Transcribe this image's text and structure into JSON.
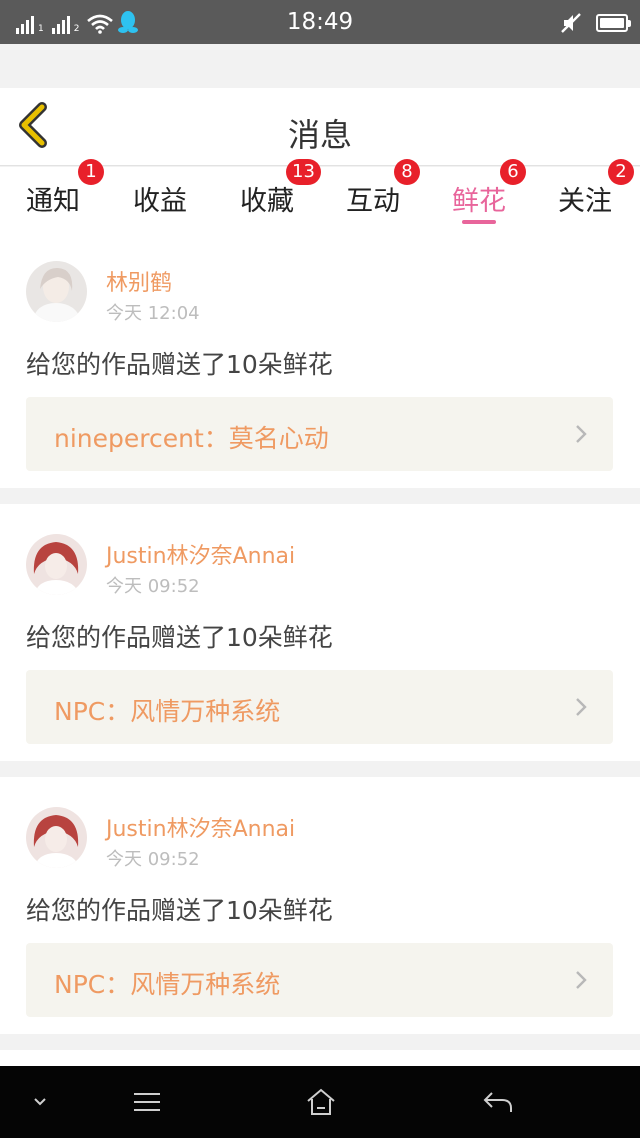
{
  "status_bar": {
    "time": "18:49",
    "sim1_label": "1",
    "sim2_label": "2"
  },
  "header": {
    "title": "消息",
    "accent_color": "#e8c000"
  },
  "tabs": [
    {
      "label": "通知",
      "badge": "1"
    },
    {
      "label": "收益",
      "badge": ""
    },
    {
      "label": "收藏",
      "badge": "13"
    },
    {
      "label": "互动",
      "badge": "8"
    },
    {
      "label": "鲜花",
      "badge": "6",
      "active": true
    },
    {
      "label": "关注",
      "badge": "2"
    }
  ],
  "colors": {
    "active_tab": "#e8659b",
    "badge": "#e8202a",
    "username": "#ef9a62",
    "work_title": "#ef9a62"
  },
  "cards": [
    {
      "username": "林别鹤",
      "time": "今天 12:04",
      "message": "给您的作品赠送了10朵鲜花",
      "work_title": "ninepercent：莫名心动"
    },
    {
      "username": "Justin林汐奈Annai",
      "time": "今天 09:52",
      "message": "给您的作品赠送了10朵鲜花",
      "work_title": "NPC：风情万种系统"
    },
    {
      "username": "Justin林汐奈Annai",
      "time": "今天 09:52",
      "message": "给您的作品赠送了10朵鲜花",
      "work_title": "NPC：风情万种系统"
    }
  ],
  "nav": {
    "buttons": [
      "chevron-down-icon",
      "menu-icon",
      "home-icon",
      "back-arrow-icon"
    ]
  }
}
